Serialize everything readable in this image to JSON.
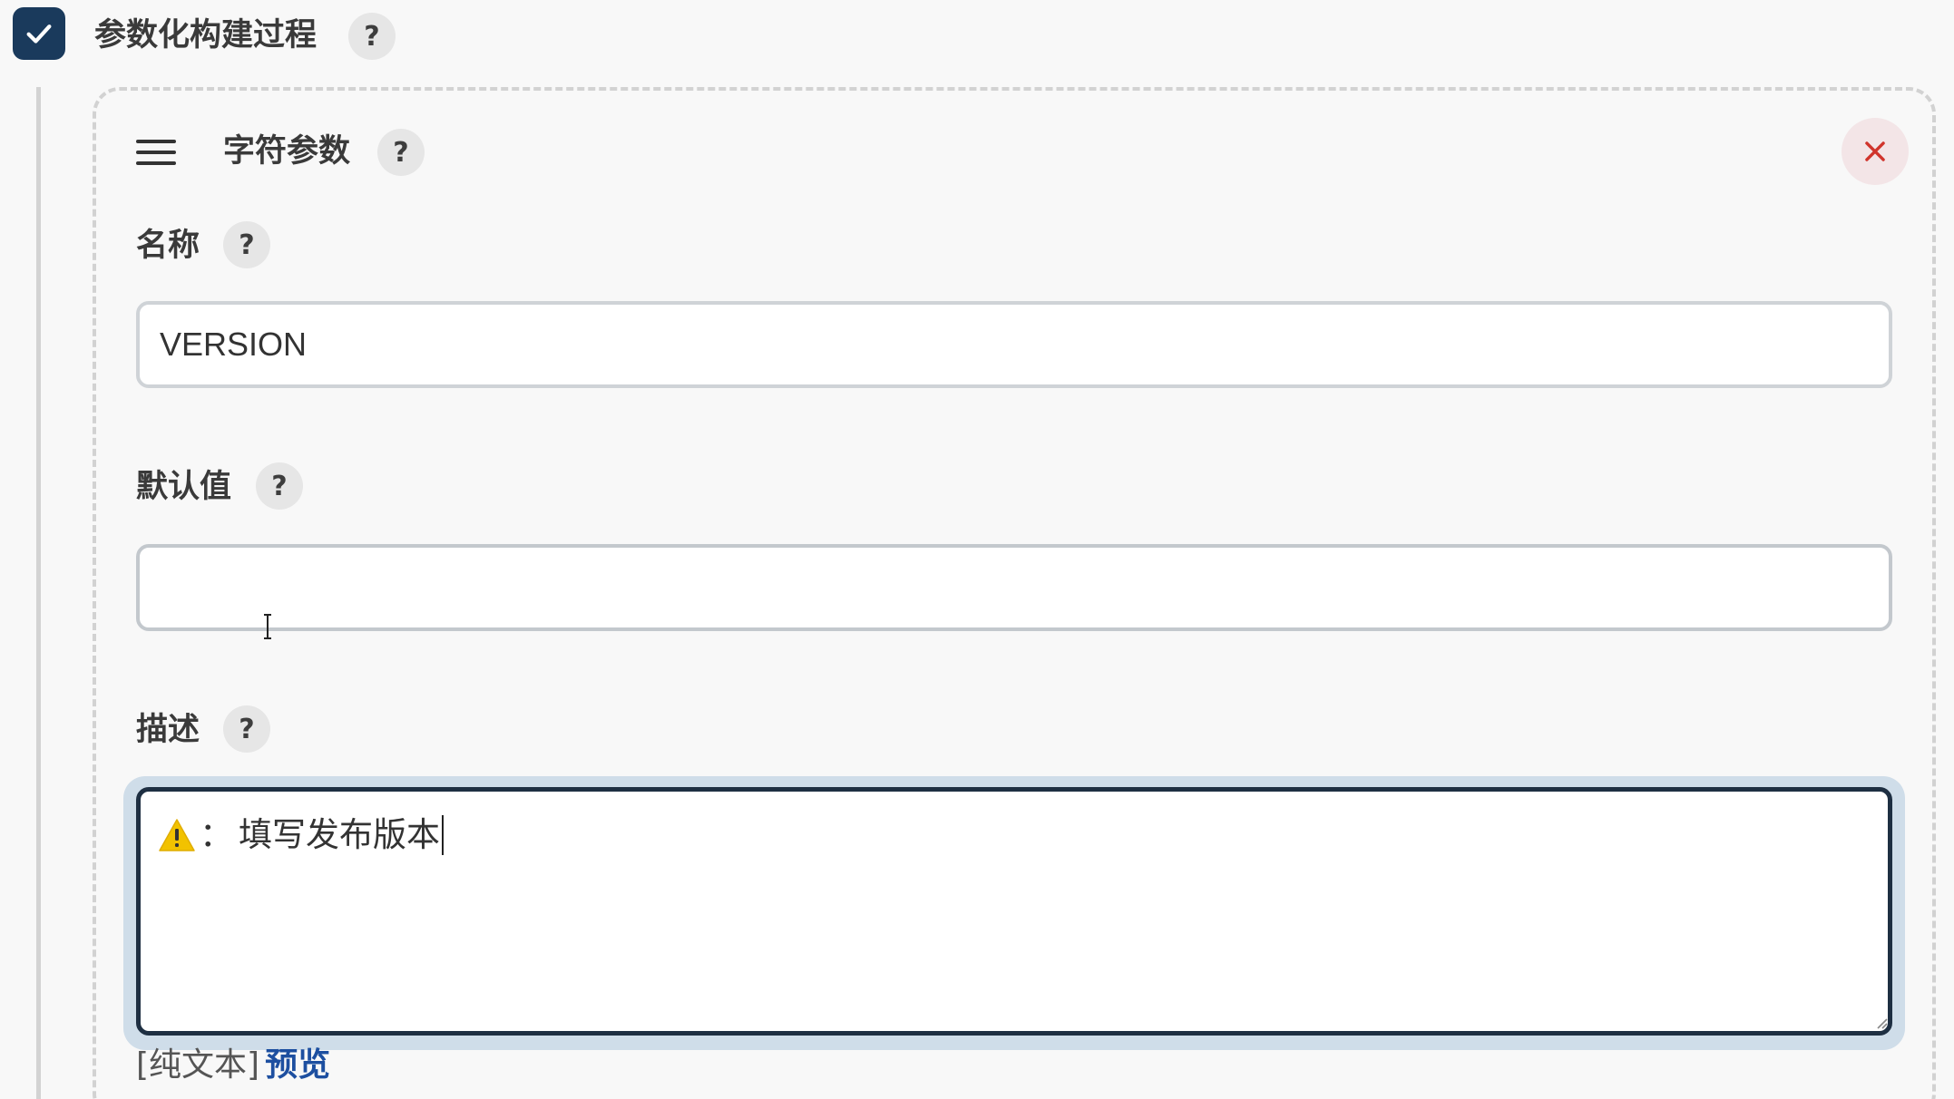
{
  "section": {
    "title": "参数化构建过程",
    "help": "?",
    "checked": true
  },
  "parameter": {
    "type_title": "字符参数",
    "help": "?",
    "name": {
      "label": "名称",
      "help": "?",
      "value": "VERSION"
    },
    "default_value": {
      "label": "默认值",
      "help": "?",
      "value": ""
    },
    "description": {
      "label": "描述",
      "help": "?",
      "warning_prefix": "：",
      "text": "填写发布版本"
    },
    "format": {
      "mode": "[纯文本]",
      "preview_link": "预览"
    }
  },
  "icons": {
    "checkbox": "check-icon",
    "drag": "drag-handle-icon",
    "close": "close-icon",
    "warning": "warning-icon"
  },
  "colors": {
    "checkbox_bg": "#1a3a5c",
    "close_icon": "#d0342c",
    "link": "#1d4fa0",
    "warning": "#f2c200",
    "focus_ring": "#cfdde9"
  }
}
